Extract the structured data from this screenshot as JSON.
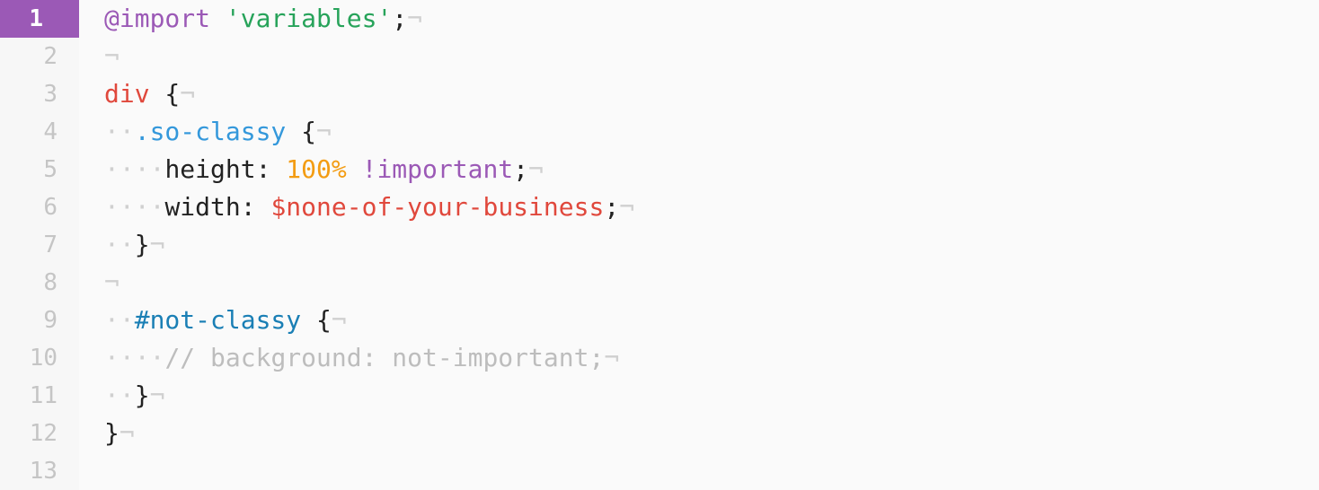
{
  "editor": {
    "active_line": 1,
    "lines": [
      {
        "number": "1",
        "tokens": [
          {
            "t": "at",
            "v": "@import"
          },
          {
            "t": "plain",
            "v": " "
          },
          {
            "t": "str",
            "v": "'variables'"
          },
          {
            "t": "plain",
            "v": ";"
          },
          {
            "t": "inv",
            "v": "¬"
          }
        ]
      },
      {
        "number": "2",
        "tokens": [
          {
            "t": "inv",
            "v": "¬"
          }
        ]
      },
      {
        "number": "3",
        "tokens": [
          {
            "t": "tag",
            "v": "div"
          },
          {
            "t": "plain",
            "v": " {"
          },
          {
            "t": "inv",
            "v": "¬"
          }
        ]
      },
      {
        "number": "4",
        "tokens": [
          {
            "t": "inv",
            "v": "··"
          },
          {
            "t": "cls",
            "v": ".so-classy"
          },
          {
            "t": "plain",
            "v": " {"
          },
          {
            "t": "inv",
            "v": "¬"
          }
        ]
      },
      {
        "number": "5",
        "tokens": [
          {
            "t": "inv",
            "v": "····"
          },
          {
            "t": "plain",
            "v": "height: "
          },
          {
            "t": "num",
            "v": "100%"
          },
          {
            "t": "plain",
            "v": " "
          },
          {
            "t": "imp",
            "v": "!important"
          },
          {
            "t": "plain",
            "v": ";"
          },
          {
            "t": "inv",
            "v": "¬"
          }
        ]
      },
      {
        "number": "6",
        "tokens": [
          {
            "t": "inv",
            "v": "····"
          },
          {
            "t": "plain",
            "v": "width: "
          },
          {
            "t": "var",
            "v": "$none-of-your-business"
          },
          {
            "t": "plain",
            "v": ";"
          },
          {
            "t": "inv",
            "v": "¬"
          }
        ]
      },
      {
        "number": "7",
        "tokens": [
          {
            "t": "inv",
            "v": "··"
          },
          {
            "t": "plain",
            "v": "}"
          },
          {
            "t": "inv",
            "v": "¬"
          }
        ]
      },
      {
        "number": "8",
        "tokens": [
          {
            "t": "inv",
            "v": "¬"
          }
        ]
      },
      {
        "number": "9",
        "tokens": [
          {
            "t": "inv",
            "v": "··"
          },
          {
            "t": "id",
            "v": "#not-classy"
          },
          {
            "t": "plain",
            "v": " {"
          },
          {
            "t": "inv",
            "v": "¬"
          }
        ]
      },
      {
        "number": "10",
        "tokens": [
          {
            "t": "inv",
            "v": "····"
          },
          {
            "t": "cmt",
            "v": "// background: not-important;"
          },
          {
            "t": "inv",
            "v": "¬"
          }
        ]
      },
      {
        "number": "11",
        "tokens": [
          {
            "t": "inv",
            "v": "··"
          },
          {
            "t": "plain",
            "v": "}"
          },
          {
            "t": "inv",
            "v": "¬"
          }
        ]
      },
      {
        "number": "12",
        "tokens": [
          {
            "t": "plain",
            "v": "}"
          },
          {
            "t": "inv",
            "v": "¬"
          }
        ]
      },
      {
        "number": "13",
        "tokens": []
      }
    ]
  },
  "colors": {
    "active_line_number_bg": "#9b59b6",
    "at_rule": "#9b59b6",
    "string": "#27a35a",
    "tag": "#e0483c",
    "class": "#3498db",
    "number": "#f39c12",
    "important": "#9b59b6",
    "variable": "#e0483c",
    "id": "#1a7fb5",
    "comment": "#bdbdbd",
    "invisibles": "#d0d0d0"
  }
}
